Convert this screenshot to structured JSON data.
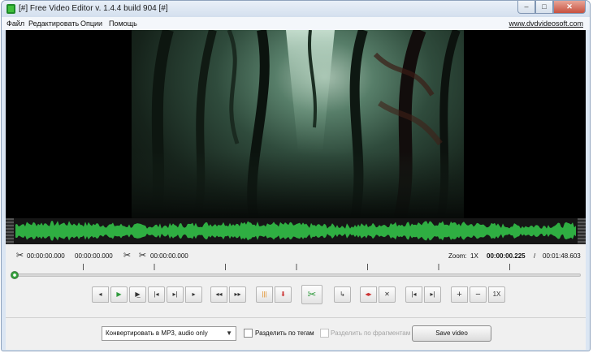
{
  "window": {
    "title": "[#] Free Video Editor v. 1.4.4 build 904 [#]",
    "controls": {
      "minimize": "–",
      "maximize": "□",
      "close": "✕"
    }
  },
  "menu": {
    "items": [
      "Файл",
      "Редактировать",
      "Опции",
      "Помощь"
    ],
    "site_link": "www.dvdvideosoft.com"
  },
  "player": {
    "selection_start": "00:00:00.000",
    "selection_end": "00:00:00.000",
    "marker_time": "00:00:00.000",
    "zoom_label": "Zoom:",
    "zoom_value": "1X",
    "current_time": "00:00:00.225",
    "separator": "/",
    "total_time": "00:01:48.603",
    "position_fraction": 0.002
  },
  "toolbar": {
    "icons": [
      "step-back-icon",
      "play-icon",
      "play-selection-icon",
      "prev-frame-icon",
      "next-frame-icon",
      "step-forward-icon",
      "go-start-icon",
      "go-end-icon",
      "pause-bars-icon",
      "marker-down-icon",
      "cut-scissors-icon",
      "rotate-icon",
      "flip-icon",
      "delete-marker-icon",
      "jump-start-icon",
      "jump-end-icon",
      "zoom-in-icon",
      "zoom-out-icon",
      "zoom-reset-icon"
    ],
    "zoom_reset_label": "1X"
  },
  "output": {
    "format_selected": "Конвертировать в MP3, audio only",
    "split_by_tags": "Разделить по тегам",
    "split_by_fragments": "Разделить по фрагментам",
    "save_label": "Save video"
  },
  "colors": {
    "accent_green": "#2f9a3c",
    "waveform_green": "#2fae42",
    "cut_red": "#cc3333"
  }
}
